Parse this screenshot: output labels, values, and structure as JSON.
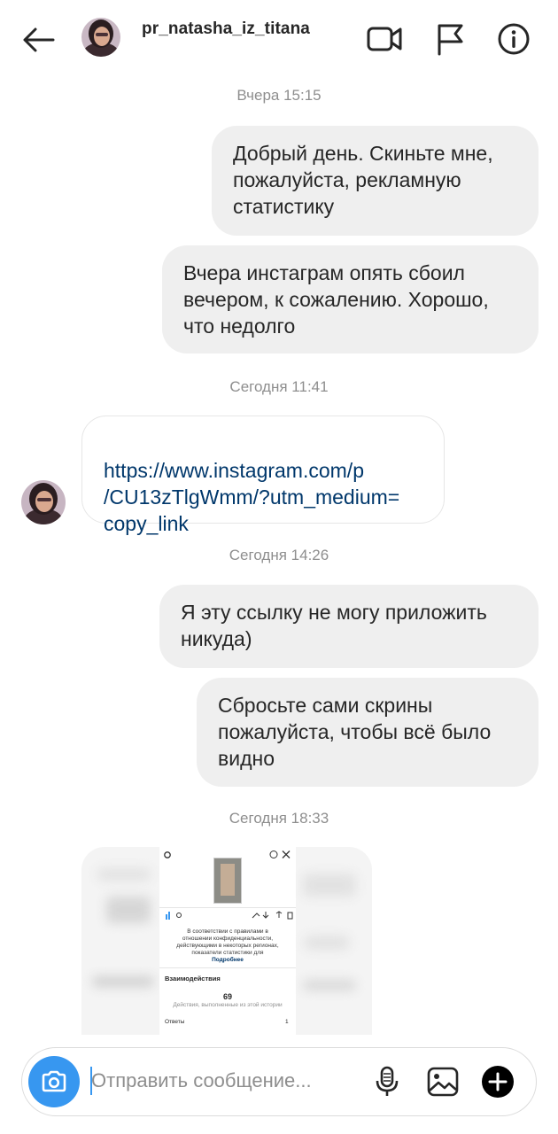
{
  "header": {
    "username": "pr_natasha_iz_titana",
    "icons": [
      "back-arrow-icon",
      "video-call-icon",
      "flag-icon",
      "info-icon"
    ]
  },
  "messages": {
    "ts1": "Вчера 15:15",
    "m1": "Добрый день. Скиньте мне,\nпожалуйста, рекламную\nстатистику",
    "m2": "Вчера инстаграм опять сбоил\nвечером, к сожалению. Хорошо,\nчто недолго",
    "ts2": "Сегодня 11:41",
    "m3": "https://www.instagram.com/p\n/CU13zTlgWmm/?utm_medium=\ncopy_link",
    "ts3": "Сегодня 14:26",
    "m4": "Я эту ссылку не могу приложить\nникуда)",
    "m5": "Сбросьте сами скрины\nпожалуйста, чтобы всё было\nвидно",
    "ts4": "Сегодня 18:33"
  },
  "screenshot_preview": {
    "privacy_text": "В соответствии с правилами в отношении конфиденциальности, действующими в некоторых регионах, показатели статистики для сообщений, например число репостов и ответов, могут быть ниже заявленных.",
    "more_link": "Подробнее",
    "interactions_label": "Взаимодействия",
    "count": "69",
    "count_caption": "Действия, выполненные из этой истории",
    "row_label": "Ответы",
    "row_value": "1"
  },
  "composer": {
    "placeholder": "Отправить сообщение..."
  },
  "colors": {
    "accent": "#3797f0",
    "bubble_out": "#efefef",
    "link": "#00376b",
    "timestamp": "#8e8e8e"
  }
}
